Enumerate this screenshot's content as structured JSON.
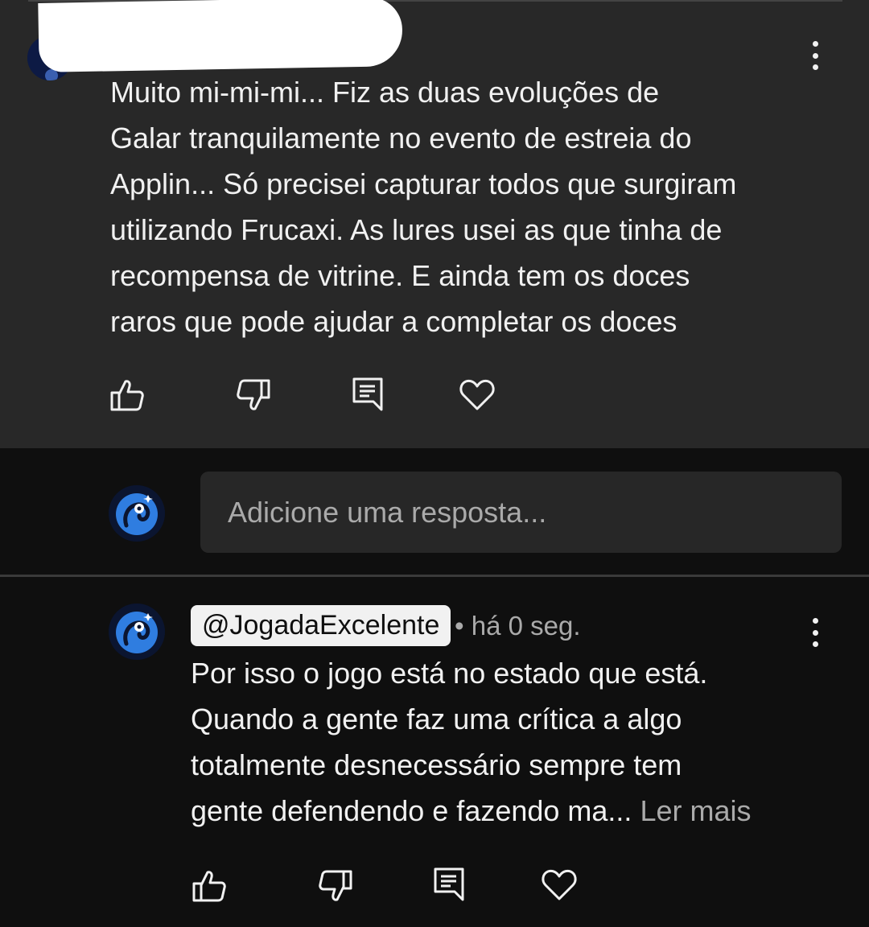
{
  "top_comment": {
    "text": "Muito mi-mi-mi... Fiz as duas evoluções de\nGalar tranquilamente no evento de estreia do\nApplin... Só precisei capturar todos que surgiram\nutilizando Frucaxi. As lures usei as que tinha de\nrecompensa de vitrine. E ainda tem os doces\nraros que pode ajudar a completar os doces",
    "actions": [
      "like-icon",
      "dislike-icon",
      "reply-icon",
      "heart-icon"
    ]
  },
  "reply_box": {
    "placeholder": "Adicione uma resposta..."
  },
  "reply": {
    "handle": "@JogadaExcelente",
    "timestamp": "• há 0 seg.",
    "text": "Por isso o jogo está no estado que está.\nQuando a gente faz uma crítica a algo\ntotalmente desnecessário sempre tem\ngente defendendo e fazendo ma... ",
    "read_more": "Ler mais",
    "actions": [
      "like-icon",
      "dislike-icon",
      "reply-icon",
      "heart-icon"
    ]
  },
  "colors": {
    "top_comment_bg": "#282828",
    "page_bg": "#0f0f0f",
    "input_bg": "#272727",
    "text_primary": "#f1f1f1",
    "text_secondary": "#aaaaaa"
  }
}
